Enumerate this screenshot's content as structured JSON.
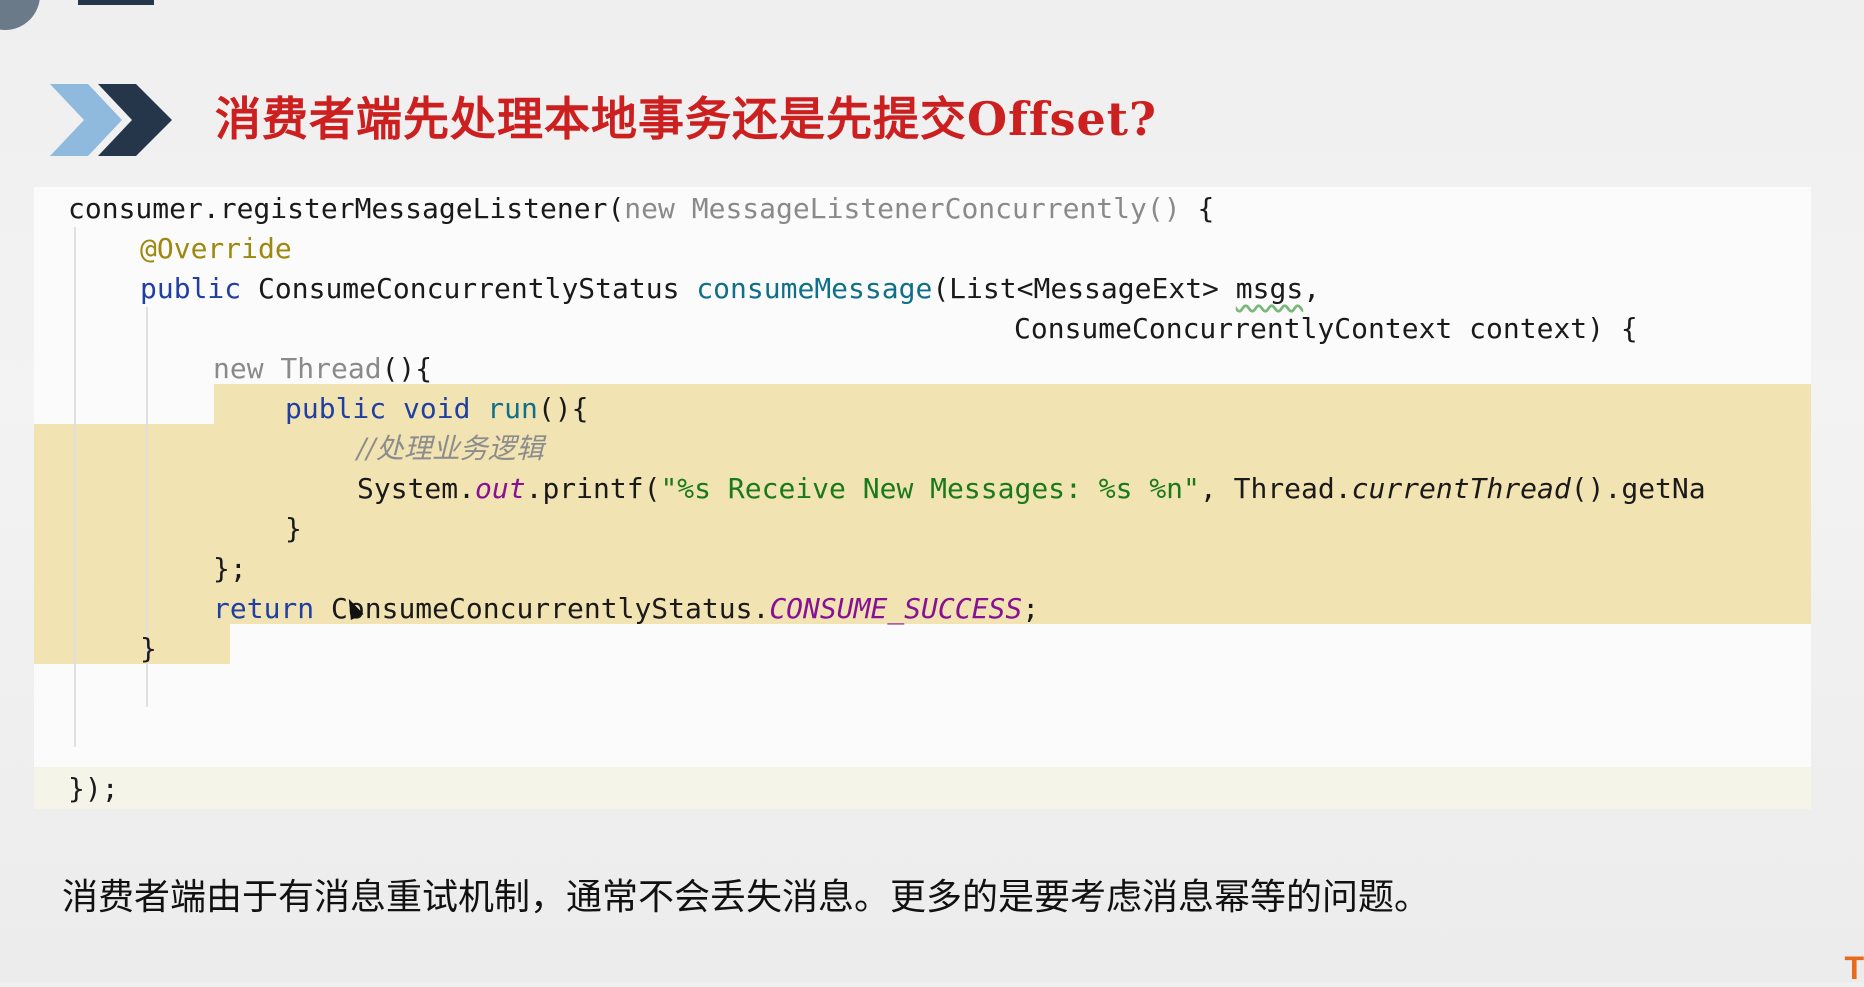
{
  "slide": {
    "title": "消费者端先处理本地事务还是先提交Offset?",
    "footer_text": "消费者端由于有消息重试机制，通常不会丢失消息。更多的是要考虑消息幂等的问题。",
    "logo_fragment": "T"
  },
  "code": {
    "l1": {
      "a": "consumer.registerMessageListener(",
      "b": "new MessageListenerConcurrently()",
      "c": " {"
    },
    "l2": {
      "a": "@Override"
    },
    "l3": {
      "a": "public",
      "b": " ConsumeConcurrentlyStatus ",
      "c": "consumeMessage",
      "d": "(List<MessageExt> ",
      "e": "msgs",
      ",": ","
    },
    "l4": {
      "a": "ConsumeConcurrentlyContext context) {"
    },
    "l5": {
      "a": "new Thread",
      "b": "(){"
    },
    "l6": {
      "a": "public void ",
      "b": "run",
      "c": "(){"
    },
    "l7": {
      "a": "//处理业务逻辑"
    },
    "l8": {
      "a": "System.",
      "b": "out",
      "c": ".printf(",
      "d": "\"%s Receive New Messages: %s %n\"",
      "e": ", Thread.",
      "f": "currentThread",
      "g": "().getNa"
    },
    "l9": {
      "a": "}"
    },
    "l10": {
      "a": "};"
    },
    "l11": {
      "a": "return",
      "b": " ConsumeConcurrentlyStatus.",
      "c": "CONSUME_SUCCESS",
      "d": ";"
    },
    "l12": {
      "a": "}"
    },
    "l13": {
      "a": "});"
    }
  },
  "colors": {
    "title": "#cc1f1f",
    "highlight": "#f2e3b3",
    "keyword": "#1f3fa3",
    "string": "#1a7a1a",
    "field": "#871094"
  },
  "icons": [
    "double-chevron-right-icon",
    "mouse-cursor-icon"
  ]
}
